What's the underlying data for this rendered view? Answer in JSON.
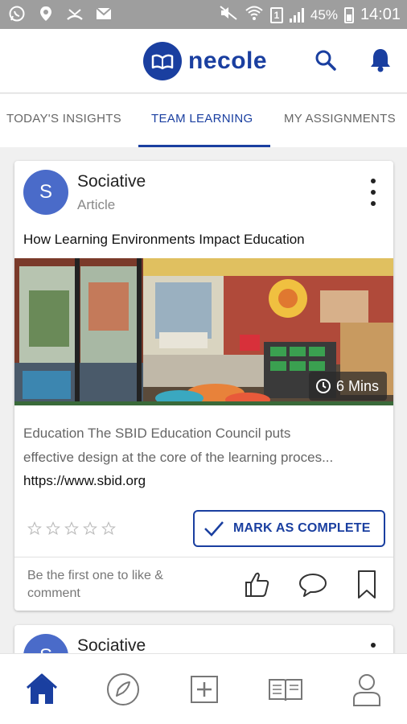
{
  "status_bar": {
    "battery": "45%",
    "sim": "1",
    "time": "14:01"
  },
  "header": {
    "logo_text": "necole",
    "icons": [
      "search-icon",
      "bell-icon"
    ],
    "brand_color": "#1a3fa0"
  },
  "tabs": [
    {
      "label": "TODAY'S INSIGHTS",
      "active": false
    },
    {
      "label": "TEAM LEARNING",
      "active": true
    },
    {
      "label": "MY ASSIGNMENTS",
      "active": false
    }
  ],
  "feed": {
    "card": {
      "avatar_letter": "S",
      "source": "Sociative",
      "type": "Article",
      "title": "How Learning Environments Impact Education",
      "duration": "6 Mins",
      "description_line1": "Education The SBID Education Council puts",
      "description_line2": "effective design at the core of the learning proces...",
      "link": "https://www.sbid.org",
      "rating": 0,
      "rating_max": 5,
      "mark_complete_label": "MARK AS COMPLETE",
      "engagement_text": "Be the first one to like & comment"
    },
    "next_card": {
      "avatar_letter": "S",
      "source": "Sociative"
    }
  },
  "bottom_nav": [
    "home-icon",
    "compass-icon",
    "add-icon",
    "book-icon",
    "profile-icon"
  ]
}
